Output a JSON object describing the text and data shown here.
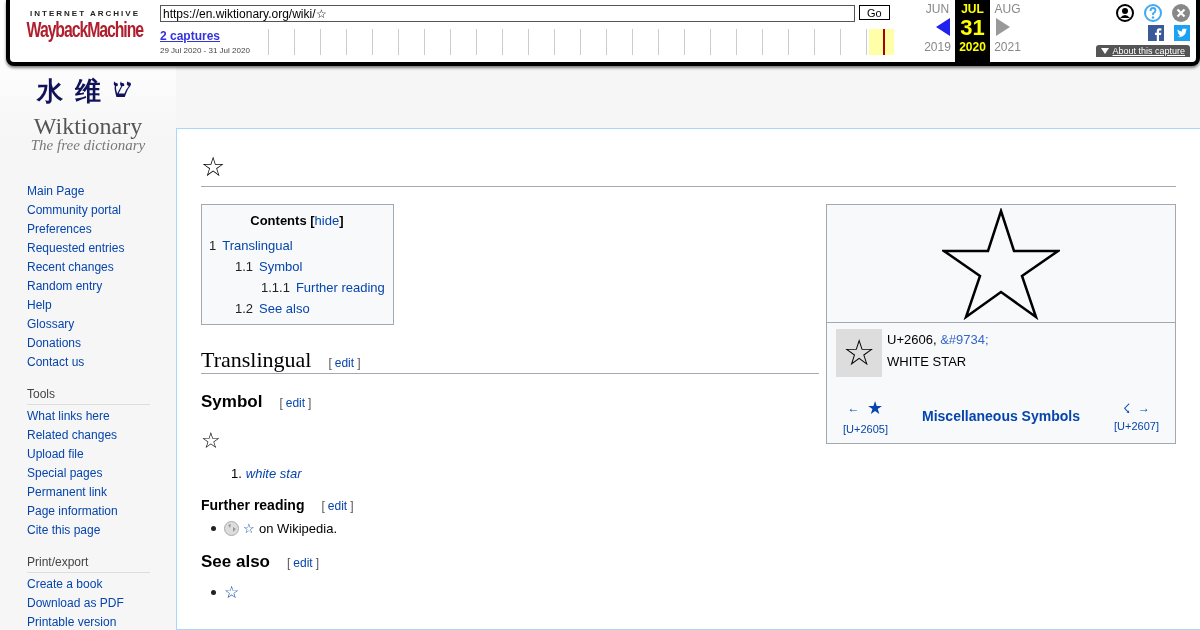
{
  "wayback": {
    "logo_top": "INTERNET ARCHIVE",
    "logo_main": "WaybackMachine",
    "url": "https://en.wiktionary.org/wiki/☆",
    "go": "Go",
    "captures": "2 captures",
    "range": "29 Jul 2020 - 31 Jul 2020",
    "months": [
      {
        "month": "JUN",
        "year": "2019",
        "selected": false,
        "kind": "prev"
      },
      {
        "month": "JUL",
        "day": "31",
        "year": "2020",
        "selected": true,
        "kind": "current"
      },
      {
        "month": "AUG",
        "year": "2021",
        "selected": false,
        "kind": "next"
      }
    ],
    "about": "About this capture"
  },
  "logo": {
    "glyphs": [
      "水",
      "维",
      "ש"
    ],
    "name": "Wiktionary",
    "tagline": "The free dictionary"
  },
  "sidebar": [
    {
      "items": [
        "Main Page",
        "Community portal",
        "Preferences",
        "Requested entries",
        "Recent changes",
        "Random entry",
        "Help",
        "Glossary",
        "Donations",
        "Contact us"
      ]
    },
    {
      "heading": "Tools",
      "items": [
        "What links here",
        "Related changes",
        "Upload file",
        "Special pages",
        "Permanent link",
        "Page information",
        "Cite this page"
      ]
    },
    {
      "heading": "Print/export",
      "items": [
        "Create a book",
        "Download as PDF",
        "Printable version"
      ]
    }
  ],
  "page_title": "☆",
  "toc": {
    "title": "Contents",
    "open": "[",
    "hide": "hide",
    "close": "]",
    "entries": [
      {
        "number": "1",
        "label": "Translingual",
        "children": [
          {
            "number": "1.1",
            "label": "Symbol",
            "children": [
              {
                "number": "1.1.1",
                "label": "Further reading"
              }
            ]
          },
          {
            "number": "1.2",
            "label": "See also"
          }
        ]
      }
    ]
  },
  "translingual": {
    "heading": "Translingual",
    "edit": {
      "open": "[",
      "label": "edit",
      "close": "]"
    }
  },
  "symbol": {
    "heading": "Symbol",
    "edit": {
      "open": "[",
      "label": "edit",
      "close": "]"
    },
    "glyph": "☆",
    "definitions": [
      {
        "number": "1.",
        "text": "white star"
      }
    ]
  },
  "further_reading": {
    "heading": "Further reading",
    "edit": {
      "open": "[",
      "label": "edit",
      "close": "]"
    },
    "items": [
      {
        "link": "☆",
        "text": "on Wikipedia."
      }
    ]
  },
  "see_also": {
    "heading": "See also",
    "edit": {
      "open": "[",
      "label": "edit",
      "close": "]"
    },
    "items": [
      "☆"
    ]
  },
  "infobox": {
    "glyph": "☆",
    "codepoint": "U+2606,",
    "entity": "&#9734;",
    "name": "WHITE STAR",
    "prev_arrow": "←",
    "prev_glyph": "★",
    "prev_code": "[U+2605]",
    "block": "Miscellaneous Symbols",
    "next_glyph": "☇",
    "next_arrow": "→",
    "next_code": "[U+2607]"
  }
}
